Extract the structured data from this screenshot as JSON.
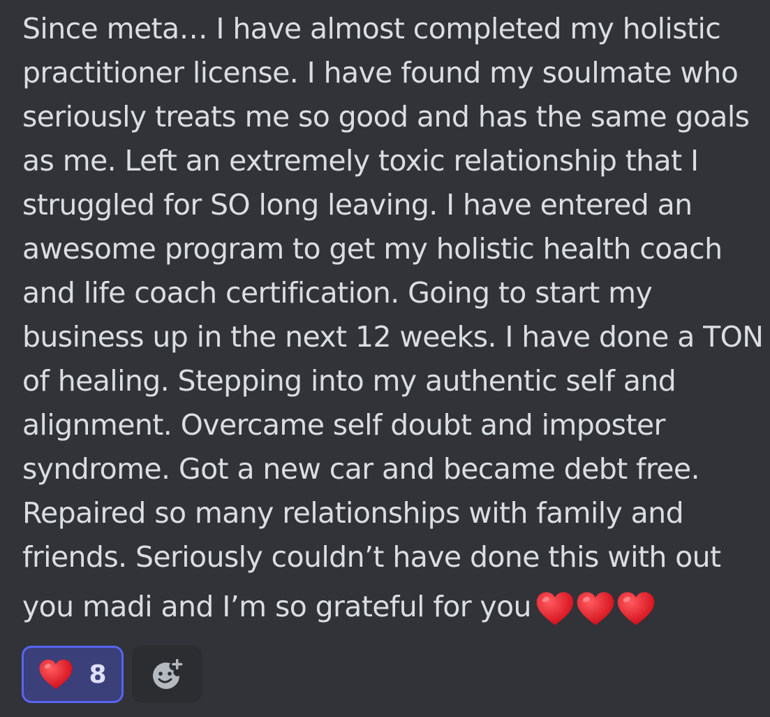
{
  "message": {
    "lines": [
      "Since meta… I have almost completed my holistic",
      "practitioner license. I have found my soulmate who",
      "seriously treats me so good and has the same goals",
      "as me. Left an extremely toxic relationship that I",
      "struggled for SO long leaving. I have entered an",
      "awesome program to get my holistic health coach",
      "and life coach certification. Going to start my",
      "business up in the next 12 weeks. I have done a TON",
      "of healing. Stepping into my authentic self and",
      "alignment. Overcame self doubt and imposter",
      "syndrome. Got a new car and became debt free.",
      "Repaired so many relationships with family and",
      "friends. Seriously couldn’t have done this with out",
      "you madi and I’m so grateful for you"
    ],
    "trailing_emoji": [
      "red-heart",
      "red-heart",
      "red-heart"
    ]
  },
  "reactions": [
    {
      "emoji": "red-heart",
      "count": "8",
      "active": true
    }
  ],
  "add_reaction": {
    "icon": "add-reaction-smiley-icon"
  },
  "colors": {
    "background": "#313338",
    "text": "#dbdee1",
    "reaction_active_bg": "#3b3f7a",
    "reaction_active_border": "#5865f2",
    "heart": "#e0161d"
  }
}
